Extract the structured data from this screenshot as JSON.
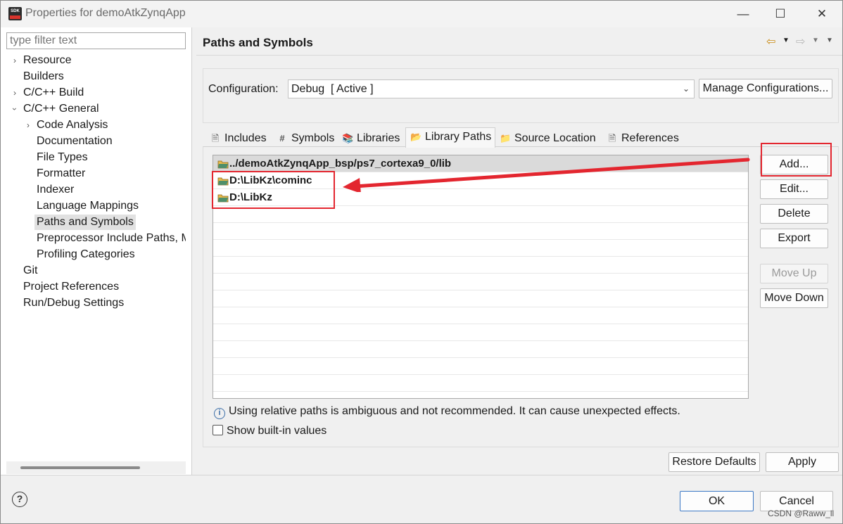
{
  "window": {
    "title": "Properties for demoAtkZynqApp",
    "icon_label": "SDK"
  },
  "left": {
    "filter_placeholder": "type filter text",
    "tree": [
      {
        "label": "Resource",
        "expander": true
      },
      {
        "label": "Builders",
        "expander": false
      },
      {
        "label": "C/C++ Build",
        "expander": true
      },
      {
        "label": "C/C++ General",
        "expander": true,
        "expanded": true
      },
      {
        "label": "Code Analysis",
        "expander": true,
        "child": true
      },
      {
        "label": "Documentation",
        "child": true
      },
      {
        "label": "File Types",
        "child": true
      },
      {
        "label": "Formatter",
        "child": true
      },
      {
        "label": "Indexer",
        "child": true
      },
      {
        "label": "Language Mappings",
        "child": true
      },
      {
        "label": "Paths and Symbols",
        "child": true,
        "selected": true
      },
      {
        "label": "Preprocessor Include Paths, M",
        "child": true
      },
      {
        "label": "Profiling Categories",
        "child": true
      },
      {
        "label": "Git"
      },
      {
        "label": "Project References"
      },
      {
        "label": "Run/Debug Settings"
      }
    ]
  },
  "page": {
    "title": "Paths and Symbols",
    "config_label": "Configuration:",
    "config_value": "Debug  [ Active ]",
    "manage_label": "Manage Configurations...",
    "tabs": [
      {
        "label": "Includes",
        "icon": "includes-icon"
      },
      {
        "label": "Symbols",
        "icon": "hash-icon"
      },
      {
        "label": "Libraries",
        "icon": "libraries-icon"
      },
      {
        "label": "Library Paths",
        "icon": "folder-icon",
        "active": true
      },
      {
        "label": "Source Location",
        "icon": "source-folder-icon"
      },
      {
        "label": "References",
        "icon": "references-icon"
      }
    ],
    "paths": [
      "../demoAtkZynqApp_bsp/ps7_cortexa9_0/lib",
      "D:\\LibKz\\cominc",
      "D:\\LibKz"
    ],
    "side_buttons": {
      "add": "Add...",
      "edit": "Edit...",
      "delete": "Delete",
      "export": "Export",
      "move_up": "Move Up",
      "move_down": "Move Down"
    },
    "info_text": "Using relative paths is ambiguous and not recommended. It can cause unexpected effects.",
    "show_builtin_label": "Show built-in values",
    "show_builtin_checked": false,
    "restore_label": "Restore Defaults",
    "apply_label": "Apply"
  },
  "footer": {
    "ok_label": "OK",
    "cancel_label": "Cancel",
    "help_symbol": "?"
  },
  "watermark": "CSDN @Raww_ll",
  "colors": {
    "annotation_red": "#e3262f",
    "accent_blue": "#3b78c4"
  }
}
